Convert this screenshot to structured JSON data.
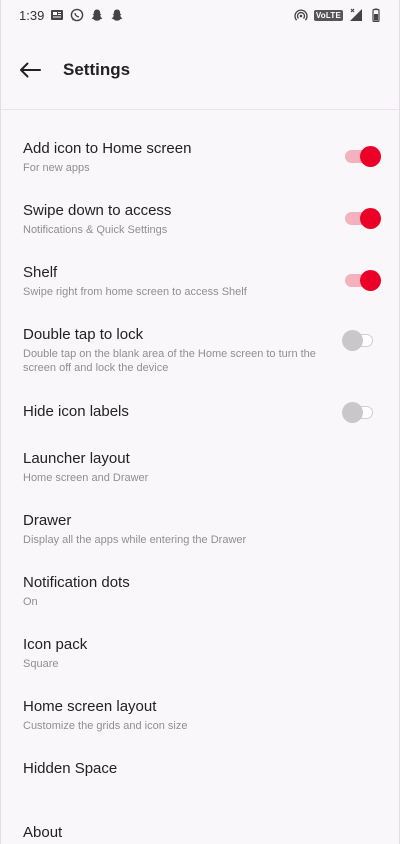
{
  "status": {
    "time": "1:39",
    "volte": "VoLTE"
  },
  "appbar": {
    "title": "Settings"
  },
  "items": [
    {
      "title": "Add icon to Home screen",
      "subtitle": "For new apps",
      "toggle": true
    },
    {
      "title": "Swipe down to access",
      "subtitle": "Notifications & Quick Settings",
      "toggle": true
    },
    {
      "title": "Shelf",
      "subtitle": "Swipe right from home screen to access Shelf",
      "toggle": true
    },
    {
      "title": "Double tap to lock",
      "subtitle": "Double tap on the blank area of the Home screen to turn the screen off and lock the device",
      "toggle": false
    },
    {
      "title": "Hide icon labels",
      "subtitle": "",
      "toggle": false
    },
    {
      "title": "Launcher layout",
      "subtitle": "Home screen and Drawer"
    },
    {
      "title": "Drawer",
      "subtitle": "Display all the apps while entering the Drawer"
    },
    {
      "title": "Notification dots",
      "subtitle": "On"
    },
    {
      "title": "Icon pack",
      "subtitle": "Square"
    },
    {
      "title": "Home screen layout",
      "subtitle": "Customize the grids and icon size"
    },
    {
      "title": "Hidden Space",
      "subtitle": ""
    },
    {
      "title": "About",
      "subtitle": ""
    }
  ],
  "colors": {
    "accent": "#eb0028",
    "accent_track": "#f3b2bd",
    "off_thumb": "#c8c8c8"
  }
}
